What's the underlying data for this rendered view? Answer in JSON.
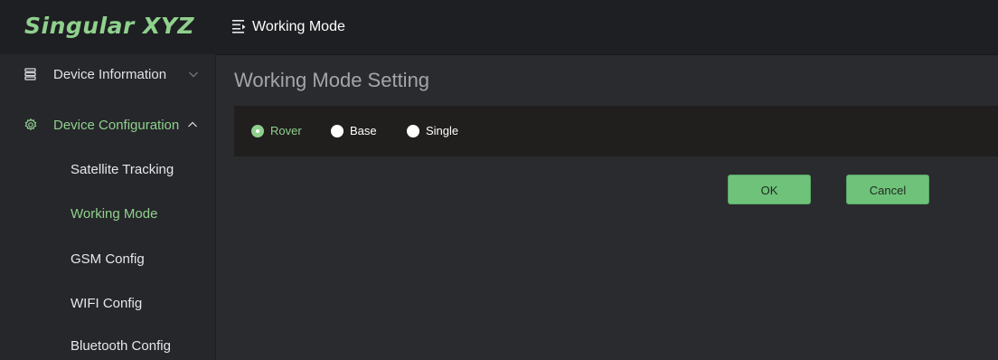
{
  "brand": {
    "logo_text": "Singular XYZ",
    "accent_color": "#8fd08d"
  },
  "header": {
    "title": "Working Mode",
    "menu_icon": "menu-fold-icon"
  },
  "sidebar": {
    "groups": [
      {
        "label": "Device Information",
        "icon": "server-icon",
        "expanded": false,
        "chevron": "chevron-down-icon"
      },
      {
        "label": "Device Configuration",
        "icon": "gear-icon",
        "expanded": true,
        "chevron": "chevron-up-icon"
      }
    ],
    "subitems": [
      {
        "label": "Satellite Tracking",
        "active": false
      },
      {
        "label": "Working Mode",
        "active": true
      },
      {
        "label": "GSM Config",
        "active": false
      },
      {
        "label": "WIFI Config",
        "active": false
      },
      {
        "label": "Bluetooth Config",
        "active": false
      }
    ]
  },
  "main": {
    "page_title": "Working Mode Setting",
    "modes": [
      {
        "label": "Rover",
        "checked": true
      },
      {
        "label": "Base",
        "checked": false
      },
      {
        "label": "Single",
        "checked": false
      }
    ],
    "ok_label": "OK",
    "cancel_label": "Cancel"
  }
}
